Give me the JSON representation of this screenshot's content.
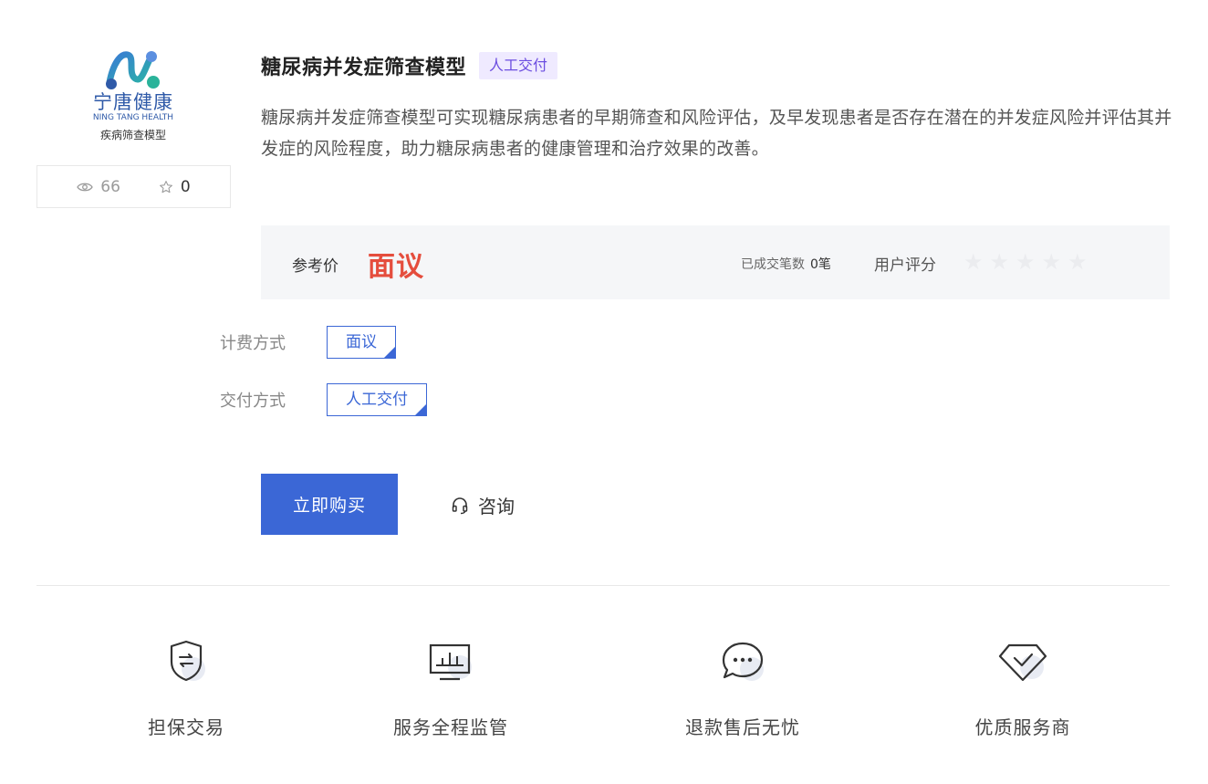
{
  "product": {
    "brand_cn": "宁唐健康",
    "brand_en": "NING TANG HEALTH",
    "logo_caption": "疾病筛查模型",
    "views": "66",
    "favorites": "0",
    "title": "糖尿病并发症筛查模型",
    "delivery_tag": "人工交付",
    "description": "糖尿病并发症筛查模型可实现糖尿病患者的早期筛查和风险评估，及早发现患者是否存在潜在的并发症风险并评估其并发症的风险程度，助力糖尿病患者的健康管理和治疗效果的改善。"
  },
  "price": {
    "label": "参考价",
    "value": "面议",
    "deals_label": "已成交笔数",
    "deals_value": "0笔",
    "rating_label": "用户评分",
    "rating": 0,
    "rating_max": 5
  },
  "options": {
    "billing_label": "计费方式",
    "billing_value": "面议",
    "delivery_label": "交付方式",
    "delivery_value": "人工交付"
  },
  "actions": {
    "buy": "立即购买",
    "consult": "咨询"
  },
  "features": [
    {
      "label": "担保交易",
      "icon": "shield-exchange-icon"
    },
    {
      "label": "服务全程监管",
      "icon": "monitor-chart-icon"
    },
    {
      "label": "退款售后无忧",
      "icon": "chat-bubble-icon"
    },
    {
      "label": "优质服务商",
      "icon": "diamond-check-icon"
    }
  ],
  "colors": {
    "primary": "#3b67d6",
    "price": "#e54d3d",
    "tag_bg": "#efeaff",
    "tag_text": "#6c4ee0",
    "panel_bg": "#f5f6f8"
  }
}
